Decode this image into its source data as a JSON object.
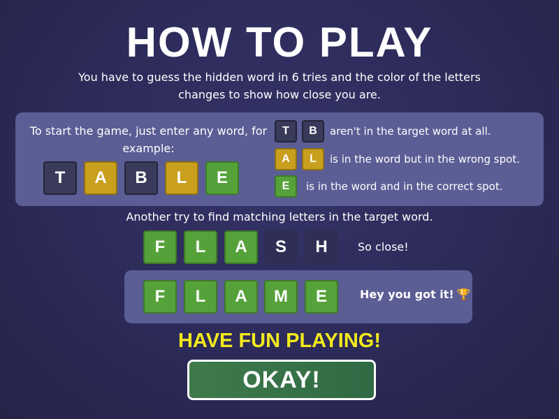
{
  "title": "HOW TO PLAY",
  "intro": "You have to guess the hidden word in 6 tries and the color of the letters changes to show how close you are.",
  "start_text": "To start the game, just enter any word, for example:",
  "example_word": [
    "T",
    "A",
    "B",
    "L",
    "E"
  ],
  "legend": {
    "absent_letters": [
      "T",
      "B"
    ],
    "absent_text": "aren't in the target word at all.",
    "present_letters": [
      "A",
      "L"
    ],
    "present_text": "is in the word but in the wrong spot.",
    "correct_letters": [
      "E"
    ],
    "correct_text": "is in the word and in the correct spot."
  },
  "another_try": "Another try to find matching letters in the target word.",
  "close_word": [
    "F",
    "L",
    "A",
    "S",
    "H"
  ],
  "close_text": "So close!",
  "win_word": [
    "F",
    "L",
    "A",
    "M",
    "E"
  ],
  "win_text": "Hey you got it!",
  "trophy": "🏆",
  "fun_text": "HAVE FUN PLAYING!",
  "okay_label": "OKAY!",
  "colors": {
    "absent": "#3a3a5a",
    "present": "#c9a01e",
    "correct": "#56a23a",
    "highlight": "#f2ea1c"
  }
}
